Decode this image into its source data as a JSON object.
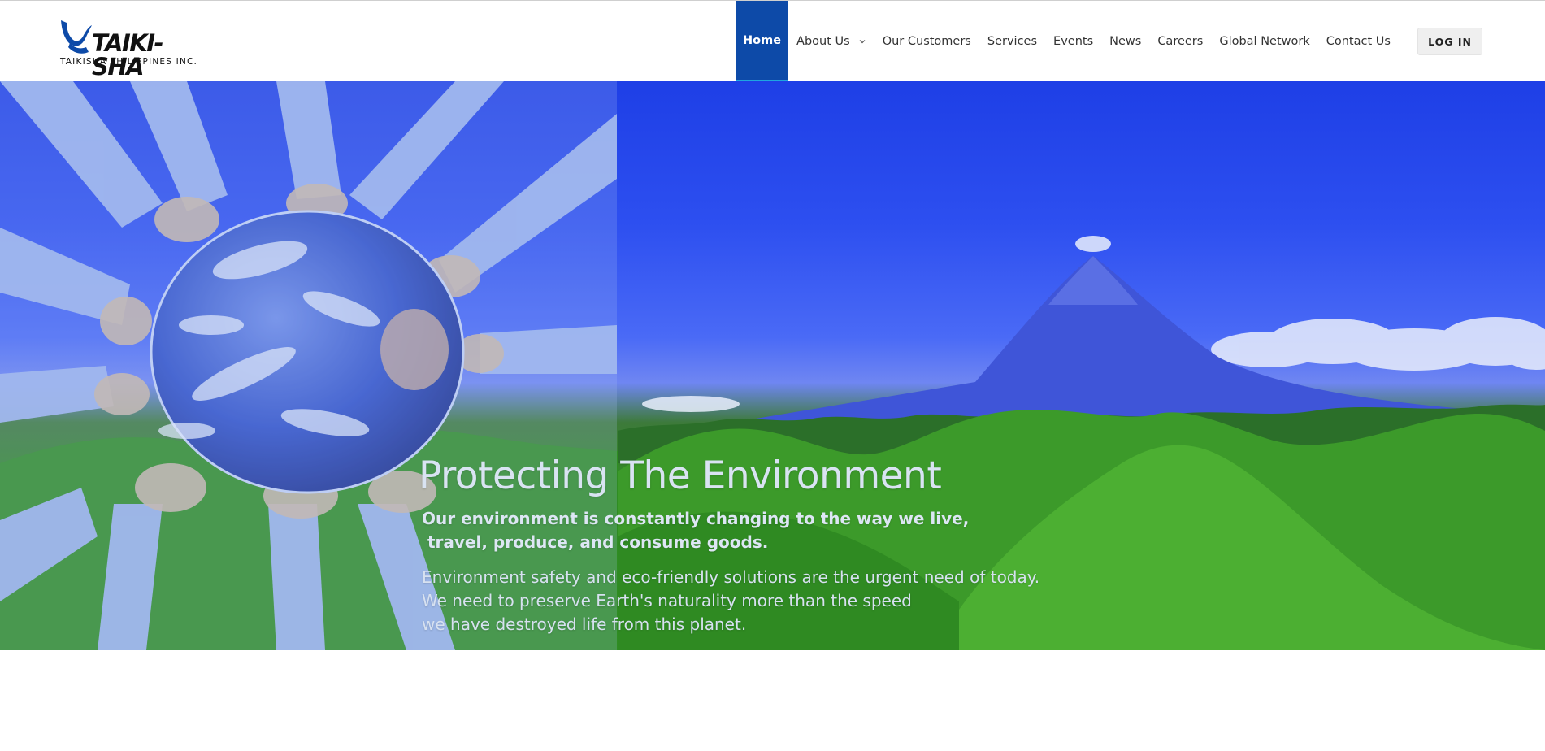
{
  "brand": {
    "name": "TAIKI-SHA",
    "subtitle": "TAIKISHA PHILIPPINES INC.",
    "logo_color": "#0d4aa8"
  },
  "nav": {
    "items": [
      {
        "label": "Home",
        "active": true
      },
      {
        "label": "About Us",
        "has_dropdown": true,
        "icon": "chevron-down-icon"
      },
      {
        "label": "Our Customers"
      },
      {
        "label": "Services"
      },
      {
        "label": "Events"
      },
      {
        "label": "News"
      },
      {
        "label": "Careers"
      },
      {
        "label": "Global Network"
      },
      {
        "label": "Contact Us"
      }
    ],
    "active_color": "#0d4aa8",
    "active_underline_color": "#1ea6e0"
  },
  "login": {
    "label": "LOG IN"
  },
  "hero": {
    "title": "Protecting The Environment",
    "lead_lines": [
      "Our environment is constantly changing to the way we live,",
      " travel, produce, and consume goods."
    ],
    "body_lines": [
      "Environment safety and eco-friendly solutions are the urgent need of today.",
      "We need to preserve Earth's naturality more than the speed",
      "we have destroyed life from this planet."
    ],
    "background_image": "earth-in-hands-and-volcano-landscape"
  }
}
